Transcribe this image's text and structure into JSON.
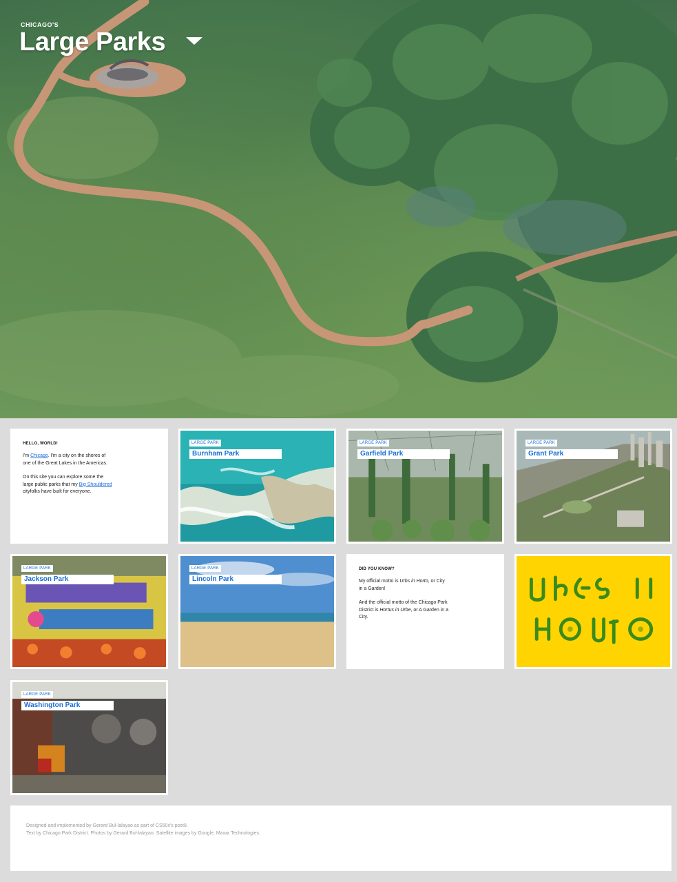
{
  "hero": {
    "subtitle": "CHICAGO'S",
    "title": "Large Parks"
  },
  "intro": {
    "heading": "HELLO, WORLD!",
    "p1_before": "I'm ",
    "p1_link": "Chicago",
    "p1_after": ". I'm a city on the shores of one of the Great Lakes in the Americas.",
    "p2_before": "On this site you can explore some the large public parks that my ",
    "p2_link": "Big Shouldered",
    "p2_after": " cityfolks have built for everyone."
  },
  "parks": [
    {
      "tag": "LARGE PARK",
      "name": "Burnham Park"
    },
    {
      "tag": "LARGE PARK",
      "name": "Garfield Park"
    },
    {
      "tag": "LARGE PARK",
      "name": "Grant Park"
    },
    {
      "tag": "LARGE PARK",
      "name": "Jackson Park"
    },
    {
      "tag": "LARGE PARK",
      "name": "Lincoln Park"
    },
    {
      "tag": "LARGE PARK",
      "name": "Washington Park"
    }
  ],
  "fact": {
    "heading": "DID YOU KNOW?",
    "p1_before": "My official motto is ",
    "p1_em": "Urbs in Horto",
    "p1_after": ", or City in a Garden!",
    "p2_before": "And the official motto of the Chicago Park District is ",
    "p2_em": "Hortus in Urbe",
    "p2_after": ", or A Garden in a City."
  },
  "footer": {
    "line1": "Designed and implemented by Gerard Bul-lalayao as part of CS50x's pset8.",
    "line2": "Text by Chicago Park District. Photos by Gerard Bul-lalayao. Satellite images by Google, Maxar Technologies."
  },
  "colors": {
    "link": "#1a6fd6",
    "motto_bg": "#ffd400",
    "motto_fg": "#3a8a1e",
    "page_bg": "#dcdcdc"
  }
}
